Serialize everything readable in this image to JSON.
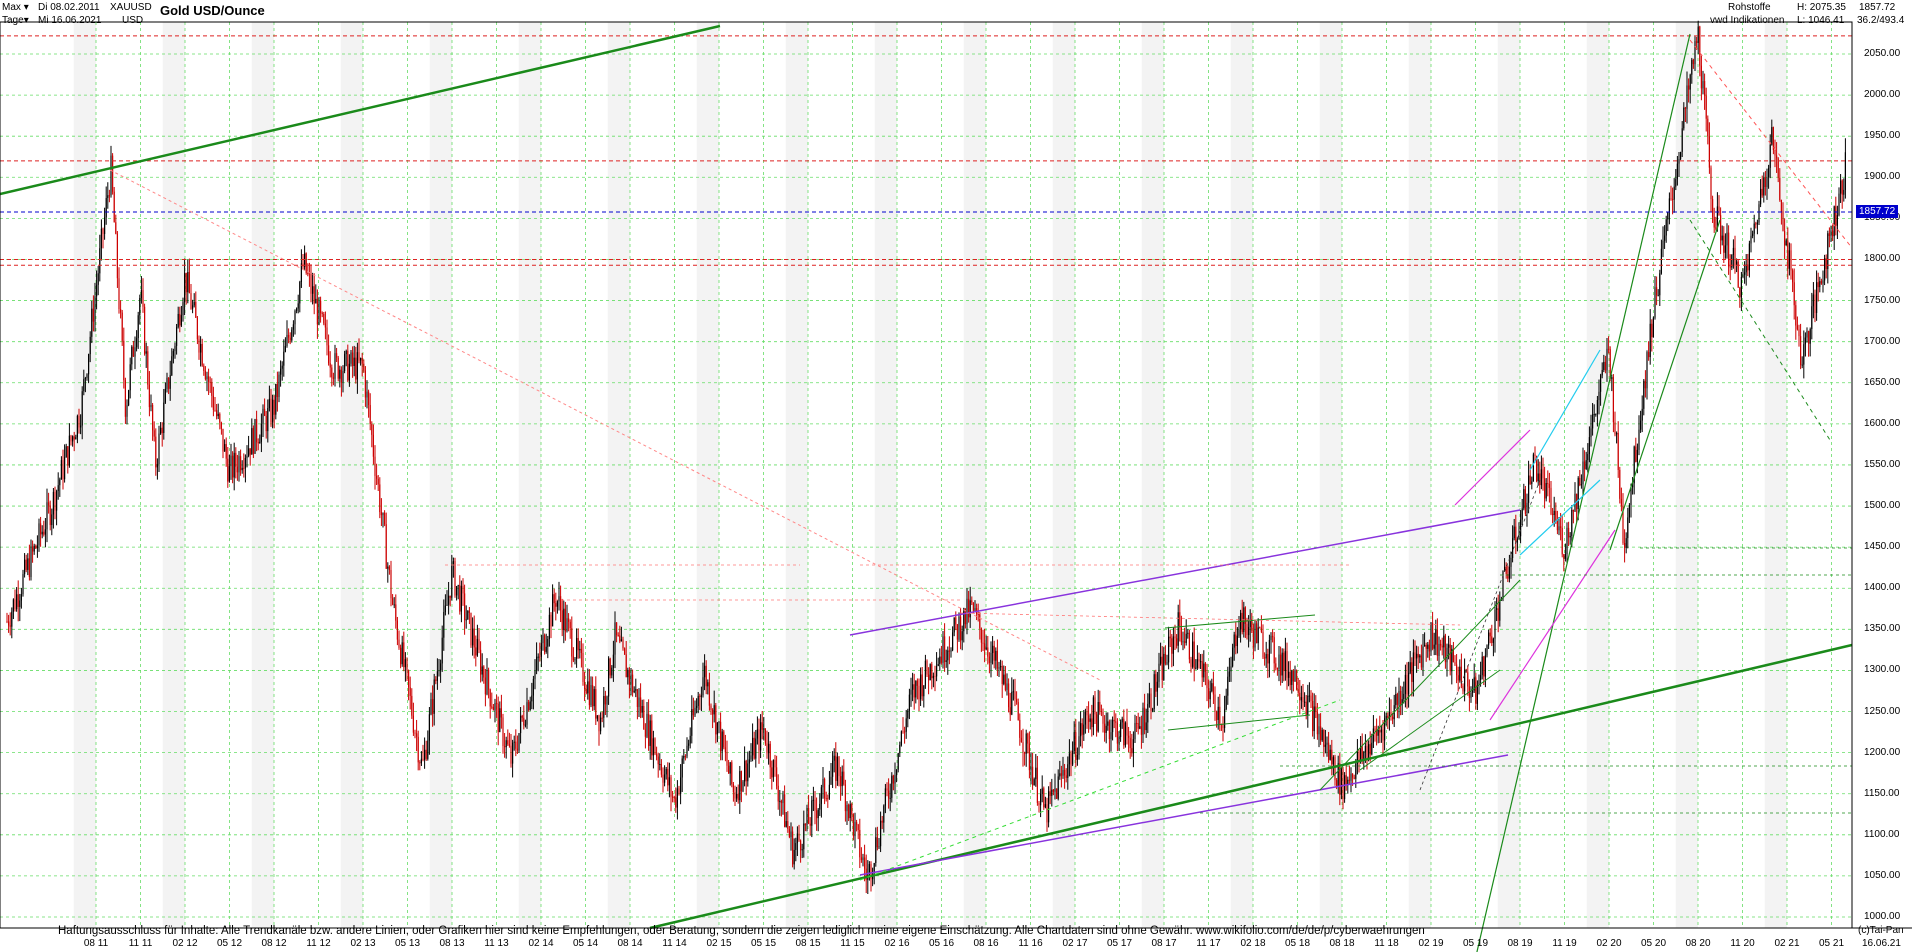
{
  "header": {
    "range_label": "Max",
    "range_arrow": "▾",
    "interval_label": "Tage",
    "interval_arrow": "▾",
    "date_from": "Di 08.02.2011",
    "date_to": "Mi 16.06.2021",
    "symbol": "XAUUSD",
    "currency": "USD",
    "title": "Gold USD/Ounce",
    "category": "Rohstoffe",
    "provider": "vwd Indikationen",
    "high": "H: 2075.35",
    "low": "L: 1046.41",
    "last_price": "1857.72",
    "ratio": "36.2/493.4"
  },
  "footer": {
    "disclaimer": "Haftungsausschluss für Inhalte: Alle Trendkanäle bzw. andere Linien, oder Grafiken hier sind keine Empfehlungen, oder Beratung, sondern die zeigen lediglich meine eigene Einschätzung. Alle Chartdaten sind ohne Gewähr.  www.wikifolio.com/de/de/p/cyberwaehrungen",
    "credit": "(c)Tai-Pan",
    "end_date": "16.06.21"
  },
  "colors": {
    "up": "#000000",
    "down": "#cc0000",
    "grid": "#66dd66",
    "trend_green": "#1a8a1a",
    "support_red": "#dd2222",
    "current_blue": "#0000cc",
    "purple": "#8833dd",
    "cyan": "#22ccee",
    "magenta": "#dd33dd"
  },
  "chart_data": {
    "type": "candlestick",
    "title": "Gold USD/Ounce",
    "ylabel": "USD",
    "ylim": [
      990,
      2095
    ],
    "y_ticks": [
      1000,
      1050,
      1100,
      1150,
      1200,
      1250,
      1300,
      1350,
      1400,
      1450,
      1500,
      1550,
      1600,
      1650,
      1700,
      1750,
      1800,
      1850,
      1900,
      1950,
      2000,
      2050
    ],
    "x_ticks": [
      "08 11",
      "11 11",
      "02 12",
      "05 12",
      "08 12",
      "11 12",
      "02 13",
      "05 13",
      "08 13",
      "11 13",
      "02 14",
      "05 14",
      "08 14",
      "11 14",
      "02 15",
      "05 15",
      "08 15",
      "11 15",
      "02 16",
      "05 16",
      "08 16",
      "11 16",
      "02 17",
      "05 17",
      "08 17",
      "11 17",
      "02 18",
      "05 18",
      "08 18",
      "11 18",
      "02 19",
      "05 19",
      "08 19",
      "11 19",
      "02 20",
      "05 20",
      "08 20",
      "11 20",
      "02 21",
      "05 21"
    ],
    "price_path": [
      {
        "date": "02.2011",
        "value": 1360
      },
      {
        "date": "05.2011",
        "value": 1500
      },
      {
        "date": "07.2011",
        "value": 1620
      },
      {
        "date": "09.2011",
        "value": 1910
      },
      {
        "date": "10.2011",
        "value": 1620
      },
      {
        "date": "11.2011",
        "value": 1760
      },
      {
        "date": "12.2011",
        "value": 1550
      },
      {
        "date": "02.2012",
        "value": 1780
      },
      {
        "date": "05.2012",
        "value": 1540
      },
      {
        "date": "08.2012",
        "value": 1620
      },
      {
        "date": "10.2012",
        "value": 1795
      },
      {
        "date": "12.2012",
        "value": 1670
      },
      {
        "date": "02.2013",
        "value": 1670
      },
      {
        "date": "04.2013",
        "value": 1380
      },
      {
        "date": "06.2013",
        "value": 1180
      },
      {
        "date": "08.2013",
        "value": 1420
      },
      {
        "date": "12.2013",
        "value": 1190
      },
      {
        "date": "03.2014",
        "value": 1390
      },
      {
        "date": "06.2014",
        "value": 1240
      },
      {
        "date": "07.2014",
        "value": 1340
      },
      {
        "date": "11.2014",
        "value": 1140
      },
      {
        "date": "01.2015",
        "value": 1300
      },
      {
        "date": "03.2015",
        "value": 1150
      },
      {
        "date": "05.2015",
        "value": 1230
      },
      {
        "date": "07.2015",
        "value": 1080
      },
      {
        "date": "10.2015",
        "value": 1185
      },
      {
        "date": "12.2015",
        "value": 1046
      },
      {
        "date": "03.2016",
        "value": 1270
      },
      {
        "date": "07.2016",
        "value": 1375
      },
      {
        "date": "10.2016",
        "value": 1250
      },
      {
        "date": "12.2016",
        "value": 1125
      },
      {
        "date": "03.2017",
        "value": 1250
      },
      {
        "date": "06.2017",
        "value": 1215
      },
      {
        "date": "09.2017",
        "value": 1355
      },
      {
        "date": "12.2017",
        "value": 1240
      },
      {
        "date": "01.2018",
        "value": 1365
      },
      {
        "date": "05.2018",
        "value": 1290
      },
      {
        "date": "08.2018",
        "value": 1160
      },
      {
        "date": "11.2018",
        "value": 1240
      },
      {
        "date": "02.2019",
        "value": 1345
      },
      {
        "date": "05.2019",
        "value": 1270
      },
      {
        "date": "09.2019",
        "value": 1555
      },
      {
        "date": "11.2019",
        "value": 1450
      },
      {
        "date": "02.2020",
        "value": 1690
      },
      {
        "date": "03.2020",
        "value": 1455
      },
      {
        "date": "05.2020",
        "value": 1740
      },
      {
        "date": "08.2020",
        "value": 2075
      },
      {
        "date": "09.2020",
        "value": 1860
      },
      {
        "date": "11.2020",
        "value": 1765
      },
      {
        "date": "01.2021",
        "value": 1950
      },
      {
        "date": "03.2021",
        "value": 1677
      },
      {
        "date": "06.2021",
        "value": 1916
      },
      {
        "date": "06.2021",
        "value": 1857.72
      }
    ],
    "horizontal_levels": [
      {
        "value": 2072,
        "style": "dashed",
        "color": "red"
      },
      {
        "value": 1920,
        "style": "dashed",
        "color": "red"
      },
      {
        "value": 1857.72,
        "style": "dashed",
        "color": "blue"
      },
      {
        "value": 1800,
        "style": "dashed",
        "color": "red"
      },
      {
        "value": 1793,
        "style": "dashed",
        "color": "red"
      }
    ],
    "grid": true
  }
}
